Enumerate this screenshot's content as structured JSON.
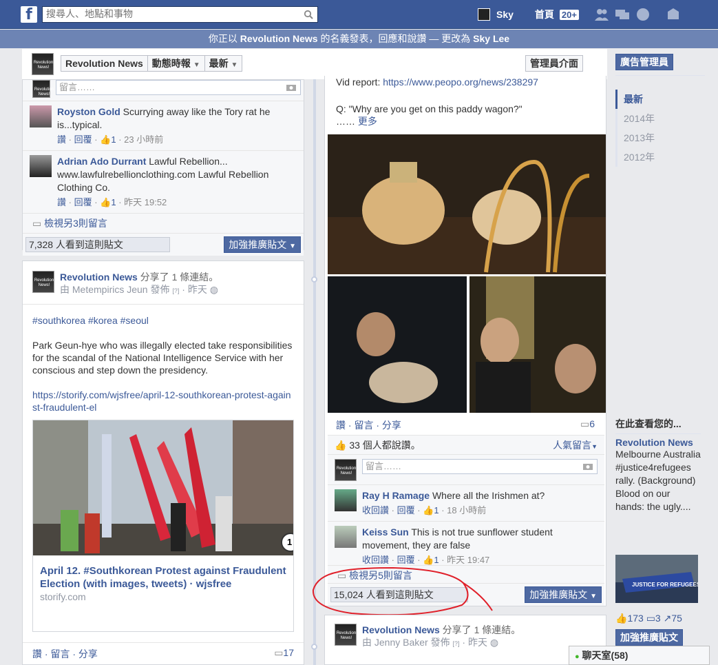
{
  "topbar": {
    "logo": "f",
    "search_placeholder": "搜尋人、地點和事物",
    "user_name": "Sky",
    "home_label": "首頁",
    "home_badge": "20+"
  },
  "banner": {
    "prefix": "你正以 ",
    "page_name": "Revolution News",
    "middle": " 的名義發表，回應和說讚 — 更改為 ",
    "switch_name": "Sky Lee"
  },
  "page_header": {
    "page_name": "Revolution News",
    "timeline_filter": "動態時報",
    "sort_label": "最新",
    "admin_panel": "管理員介面"
  },
  "post1": {
    "comment_placeholder": "留言……",
    "comments": [
      {
        "name": "Royston Gold",
        "text": "Scurrying away like the Tory rat he is...typical.",
        "like_label": "讚",
        "reply_label": "回覆",
        "likes": "1",
        "time": "23 小時前"
      },
      {
        "name": "Adrian Ado Durrant",
        "text": "Lawful Rebellion... www.lawfulrebellionclothing.com Lawful Rebellion Clothing Co.",
        "like_label": "讚",
        "reply_label": "回覆",
        "likes": "1",
        "time": "昨天 19:52"
      }
    ],
    "view_more": "檢視另3則留言",
    "views": "7,328 人看到這則貼文",
    "boost": "加強推廣貼文"
  },
  "post2": {
    "page_name": "Revolution News",
    "action": " 分享了 1 條連結。",
    "by_prefix": "由 ",
    "author": "Metempirics Jeun",
    "posted": " 發佈 ",
    "time": "昨天",
    "hashtags": "#southkorea #korea #seoul",
    "body": "Park Geun-hye who was illegally elected take responsibilities for the scandal of the National Intelligence Service with her conscious and step down the presidency.",
    "url": "https://storify.com/wjsfree/april-12-southkorean-protest-against-fraudulent-el",
    "link_title": "April 12. #Southkorean Protest against Fraudulent Election (with images, tweets) · wjsfree",
    "link_domain": "storify.com",
    "photo_badge": "1",
    "action_like": "讚",
    "action_comment": "留言",
    "action_share": "分享",
    "comment_count": "17"
  },
  "post3": {
    "vid_label": "Vid report: ",
    "vid_url": "https://www.peopo.org/news/238297",
    "question": "Q: \"Why are you get on this paddy wagon?\"",
    "more_prefix": "…… ",
    "more": "更多",
    "action_like": "讚",
    "action_comment": "留言",
    "action_share": "分享",
    "share_count": "6",
    "likes_text": "33 個人都說讚。",
    "popular": "人氣留言",
    "comment_placeholder": "留言……",
    "comments": [
      {
        "name": "Ray H Ramage",
        "text": "Where all the Irishmen at?",
        "like_label": "收回讚",
        "reply_label": "回覆",
        "likes": "1",
        "time": "18 小時前"
      },
      {
        "name": "Keiss Sun",
        "text": "This is not true sunflower student movement, they are false",
        "like_label": "收回讚",
        "reply_label": "回覆",
        "likes": "1",
        "time": "昨天 19:47"
      }
    ],
    "view_more": "檢視另5則留言",
    "views": "15,024 人看到這則貼文",
    "boost": "加強推廣貼文"
  },
  "post4": {
    "page_name": "Revolution News",
    "action": " 分享了 1 條連結。",
    "by_prefix": "由 ",
    "author": "Jenny Baker",
    "posted": " 發佈 ",
    "time": "昨天"
  },
  "sidebar": {
    "ads_manager": "廣告管理員",
    "years": [
      "最新",
      "2014年",
      "2013年",
      "2012年"
    ],
    "see_here": "在此查看您的...",
    "promo_title": "Revolution News",
    "promo_text": "Melbourne Australia #justice4refugees rally. (Background) Blood on our hands: the ugly....",
    "banner_text": "JUSTICE FOR REFUGEES",
    "likes": "173",
    "comments": "3",
    "shares": "75",
    "boost": "加強推廣貼文"
  },
  "chat": {
    "label": "聊天室(58)"
  }
}
